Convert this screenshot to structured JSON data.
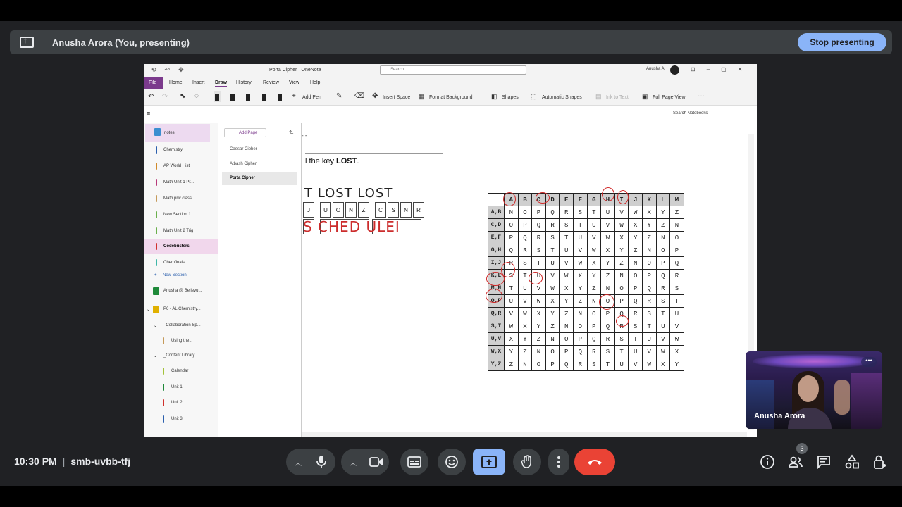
{
  "meet": {
    "presenting_title": "Anusha Arora (You, presenting)",
    "stop_label": "Stop presenting",
    "time": "10:30 PM",
    "meeting_code": "smb-uvbb-tfj",
    "participant_badge": "3",
    "tile_name": "Anusha Arora",
    "accent_color": "#8ab4f8",
    "hangup_color": "#ea4335"
  },
  "onenote": {
    "title": "Porta Cipher  ·  OneNote",
    "search_placeholder": "Search",
    "user": "Anusha A",
    "menu": [
      "File",
      "Home",
      "Insert",
      "Draw",
      "History",
      "Review",
      "View",
      "Help"
    ],
    "ribbon": {
      "add_pen": "Add Pen",
      "insert_space": "Insert Space",
      "format_background": "Format Background",
      "shapes": "Shapes",
      "automatic_shapes": "Automatic Shapes",
      "ink_to_text": "Ink to Text",
      "full_page_view": "Full Page View"
    },
    "search_notebooks": "Search Notebooks",
    "notebook": "notes",
    "sections": [
      {
        "label": "Chemistry",
        "color": "#2b5fad"
      },
      {
        "label": "AP World Hist",
        "color": "#d08a2a"
      },
      {
        "label": "Math Unit 1 Pr...",
        "color": "#b83a7a"
      },
      {
        "label": "Math priv class",
        "color": "#c59a5a"
      },
      {
        "label": "New Section 1",
        "color": "#6ab04c"
      },
      {
        "label": "Math Unit 2 Trig",
        "color": "#6ab04c"
      },
      {
        "label": "Codebusters",
        "color": "#d0312d"
      },
      {
        "label": "Chemfinals",
        "color": "#3fb7a8"
      }
    ],
    "new_section": "New Section",
    "notebook2": "Anusha @ Bellevu...",
    "notebook3": "P6 - AL Chemistry...",
    "collab": "_Collaboration Sp...",
    "using": "Using the...",
    "content_lib": "_Content Library",
    "sub_sections": [
      {
        "label": "Calendar",
        "color": "#a3c23a"
      },
      {
        "label": "Unit 1",
        "color": "#1f8a3a"
      },
      {
        "label": "Unit 2",
        "color": "#d0312d"
      },
      {
        "label": "Unit 3",
        "color": "#2b5fad"
      }
    ],
    "add_page": "Add Page",
    "pages": [
      "Caesar Cipher",
      "Atbash Cipher",
      "Porta Cipher"
    ],
    "page": {
      "dashes": "- -",
      "key_prefix": "l the key ",
      "key_word": "LOST",
      "key_suffix": ".",
      "hand_key": "T LOST LOST",
      "plain_letters": [
        "J",
        "U",
        "O",
        "N",
        "Z",
        "C",
        "S",
        "N",
        "R"
      ],
      "red_decoded": "S CHED ULEI"
    },
    "porta_table": {
      "columns": [
        "A",
        "B",
        "C",
        "D",
        "E",
        "F",
        "G",
        "H",
        "I",
        "J",
        "K",
        "L",
        "M"
      ],
      "rows": [
        {
          "key": "A,B",
          "cells": [
            "N",
            "O",
            "P",
            "Q",
            "R",
            "S",
            "T",
            "U",
            "V",
            "W",
            "X",
            "Y",
            "Z"
          ]
        },
        {
          "key": "C,D",
          "cells": [
            "O",
            "P",
            "Q",
            "R",
            "S",
            "T",
            "U",
            "V",
            "W",
            "X",
            "Y",
            "Z",
            "N"
          ]
        },
        {
          "key": "E,F",
          "cells": [
            "P",
            "Q",
            "R",
            "S",
            "T",
            "U",
            "V",
            "W",
            "X",
            "Y",
            "Z",
            "N",
            "O"
          ]
        },
        {
          "key": "G,H",
          "cells": [
            "Q",
            "R",
            "S",
            "T",
            "U",
            "V",
            "W",
            "X",
            "Y",
            "Z",
            "N",
            "O",
            "P"
          ]
        },
        {
          "key": "I,J",
          "cells": [
            "R",
            "S",
            "T",
            "U",
            "V",
            "W",
            "X",
            "Y",
            "Z",
            "N",
            "O",
            "P",
            "Q"
          ]
        },
        {
          "key": "K,L",
          "cells": [
            "S",
            "T",
            "U",
            "V",
            "W",
            "X",
            "Y",
            "Z",
            "N",
            "O",
            "P",
            "Q",
            "R"
          ]
        },
        {
          "key": "M,N",
          "cells": [
            "T",
            "U",
            "V",
            "W",
            "X",
            "Y",
            "Z",
            "N",
            "O",
            "P",
            "Q",
            "R",
            "S"
          ]
        },
        {
          "key": "O,P",
          "cells": [
            "U",
            "V",
            "W",
            "X",
            "Y",
            "Z",
            "N",
            "O",
            "P",
            "Q",
            "R",
            "S",
            "T"
          ]
        },
        {
          "key": "Q,R",
          "cells": [
            "V",
            "W",
            "X",
            "Y",
            "Z",
            "N",
            "O",
            "P",
            "Q",
            "R",
            "S",
            "T",
            "U"
          ]
        },
        {
          "key": "S,T",
          "cells": [
            "W",
            "X",
            "Y",
            "Z",
            "N",
            "O",
            "P",
            "Q",
            "R",
            "S",
            "T",
            "U",
            "V"
          ]
        },
        {
          "key": "U,V",
          "cells": [
            "X",
            "Y",
            "Z",
            "N",
            "O",
            "P",
            "Q",
            "R",
            "S",
            "T",
            "U",
            "V",
            "W"
          ]
        },
        {
          "key": "W,X",
          "cells": [
            "Y",
            "Z",
            "N",
            "O",
            "P",
            "Q",
            "R",
            "S",
            "T",
            "U",
            "V",
            "W",
            "X"
          ]
        },
        {
          "key": "Y,Z",
          "cells": [
            "Z",
            "N",
            "O",
            "P",
            "Q",
            "R",
            "S",
            "T",
            "U",
            "V",
            "W",
            "X",
            "Y"
          ]
        }
      ]
    }
  }
}
